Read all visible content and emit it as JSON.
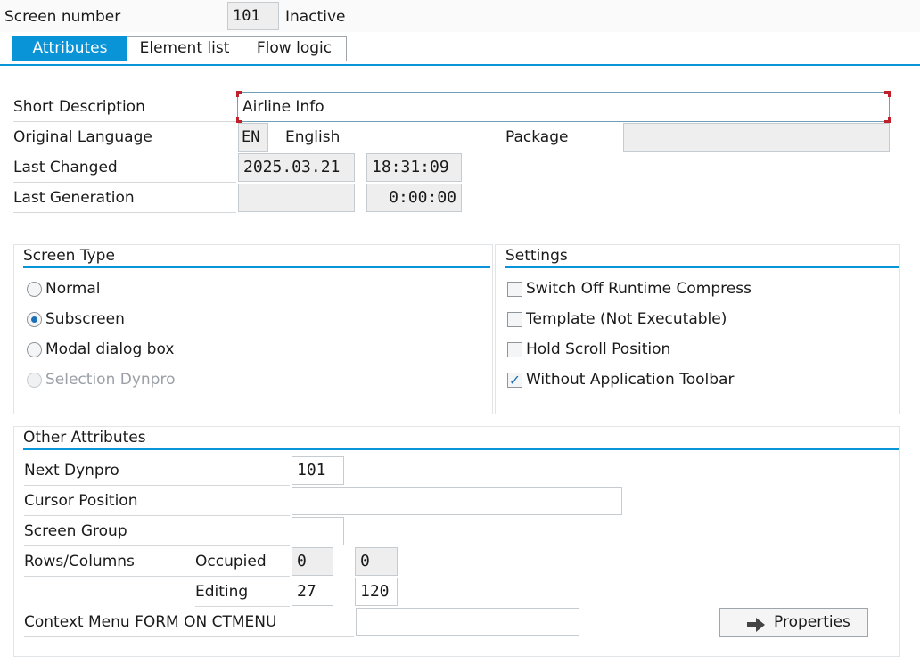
{
  "header": {
    "screen_number_label": "Screen number",
    "screen_number_value": "101",
    "status": "Inactive"
  },
  "tabs": [
    {
      "label": "Attributes",
      "active": true
    },
    {
      "label": "Element list",
      "active": false
    },
    {
      "label": "Flow logic",
      "active": false
    }
  ],
  "attributes": {
    "short_description_label": "Short Description",
    "short_description_value": "Airline Info",
    "original_language_label": "Original Language",
    "language_code": "EN",
    "language_name": "English",
    "package_label": "Package",
    "package_value": "",
    "last_changed_label": "Last Changed",
    "last_changed_date": "2025.03.21",
    "last_changed_time": "18:31:09",
    "last_generation_label": "Last Generation",
    "last_generation_date": "",
    "last_generation_time": "0:00:00"
  },
  "screen_type": {
    "title": "Screen Type",
    "options": [
      {
        "label": "Normal",
        "selected": false,
        "disabled": false
      },
      {
        "label": "Subscreen",
        "selected": true,
        "disabled": false
      },
      {
        "label": "Modal dialog box",
        "selected": false,
        "disabled": false
      },
      {
        "label": "Selection Dynpro",
        "selected": false,
        "disabled": true
      }
    ]
  },
  "settings": {
    "title": "Settings",
    "options": [
      {
        "label": "Switch Off Runtime Compress",
        "checked": false
      },
      {
        "label": "Template (Not Executable)",
        "checked": false
      },
      {
        "label": "Hold Scroll Position",
        "checked": false
      },
      {
        "label": "Without Application Toolbar",
        "checked": true
      }
    ]
  },
  "other_attributes": {
    "title": "Other Attributes",
    "next_dynpro_label": "Next Dynpro",
    "next_dynpro_value": "101",
    "cursor_position_label": "Cursor Position",
    "cursor_position_value": "",
    "screen_group_label": "Screen Group",
    "screen_group_value": "",
    "rows_columns_label": "Rows/Columns",
    "occupied_label": "Occupied",
    "occupied_rows": "0",
    "occupied_cols": "0",
    "editing_label": "Editing",
    "editing_rows": "27",
    "editing_cols": "120",
    "context_menu_label": "Context Menu FORM ON CTMENU",
    "context_menu_value": "",
    "properties_button": "Properties"
  },
  "colors": {
    "accent": "#0a94d8",
    "focus_corner": "#c0202a",
    "readonly_bg": "#eeeeee"
  }
}
